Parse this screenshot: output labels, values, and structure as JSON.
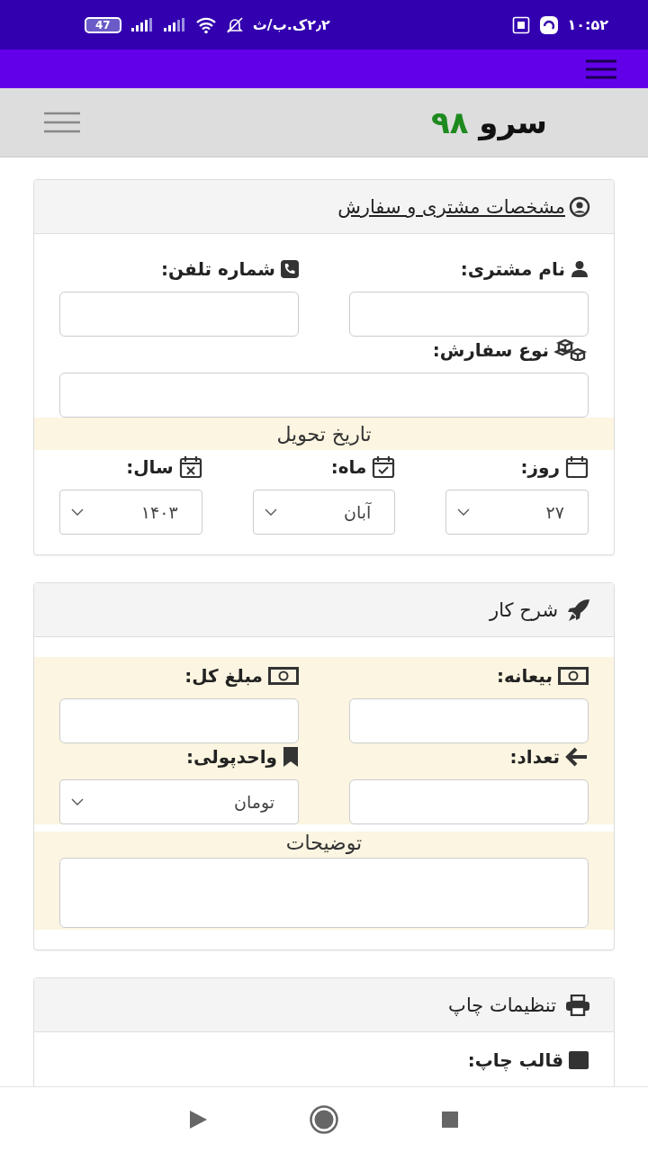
{
  "status_bar": {
    "time": "۱۰:۵۲",
    "network_speed": "۲٫۲ک.ب/ث",
    "battery": "47"
  },
  "header": {
    "brand_name": "سرو",
    "brand_number": "۹۸"
  },
  "customer_section": {
    "title": "مشخصات مشتری و سفارش",
    "customer_name": {
      "label": "نام مشتری:"
    },
    "phone": {
      "label": "شماره تلفن:"
    },
    "order_type": {
      "label": "نوع سفارش:"
    },
    "delivery_date": {
      "heading": "تاریخ تحویل",
      "parts": [
        {
          "kind": "day",
          "label": "روز:",
          "value": "۲۷"
        },
        {
          "kind": "month",
          "label": "ماه:",
          "value": "آبان"
        },
        {
          "kind": "year",
          "label": "سال:",
          "value": "۱۴۰۳"
        }
      ]
    }
  },
  "job_section": {
    "title": "شرح کار",
    "deposit": {
      "label": "بیعانه:"
    },
    "total": {
      "label": "مبلغ کل:"
    },
    "quantity": {
      "label": "تعداد:"
    },
    "currency": {
      "label": "واحدپولی:",
      "value": "تومان"
    },
    "notes": {
      "label": "توضیحات"
    }
  },
  "print_section": {
    "title": "تنظیمات چاپ",
    "template": {
      "label": "قالب چاپ:"
    }
  }
}
